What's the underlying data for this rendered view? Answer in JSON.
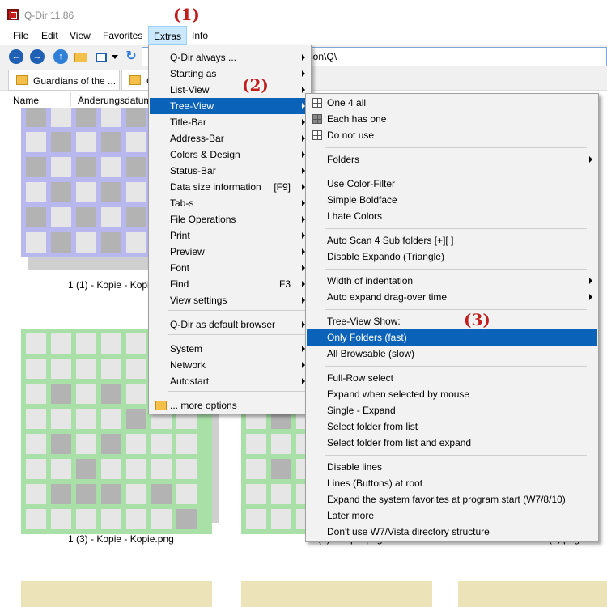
{
  "window": {
    "title": "Q-Dir 11.86"
  },
  "menubar": [
    "File",
    "Edit",
    "View",
    "Favorites",
    "Extras",
    "Info"
  ],
  "address": {
    "path": "g\\icon\\Q\\"
  },
  "tabs": [
    "Guardians of the ...",
    "C"
  ],
  "columns": {
    "name": "Name",
    "changed": "Änderungsdatum"
  },
  "files": [
    {
      "name": "1 (1) - Kopie - Kopie",
      "color": "#b8b8ee"
    },
    {
      "name": "1 (3) - Kopie - Kopie.png",
      "color": "#a8e0a8"
    },
    {
      "name": "1 (3) - Kopie.png",
      "color": "#a8e0a8"
    },
    {
      "name": "1 (3).png",
      "color": "#a8e0a8"
    },
    {
      "name": "",
      "color": "#ece4b8"
    }
  ],
  "extras_menu": {
    "items": [
      {
        "label": "Q-Dir always ...",
        "sub": true
      },
      {
        "label": "Starting as",
        "sub": true
      },
      {
        "label": "List-View",
        "sub": true
      },
      {
        "label": "Tree-View",
        "sub": true,
        "active": true
      },
      {
        "label": "Title-Bar",
        "sub": true
      },
      {
        "label": "Address-Bar",
        "sub": true
      },
      {
        "label": "Colors & Design",
        "sub": true
      },
      {
        "label": "Status-Bar",
        "sub": true
      },
      {
        "label": "Data size information",
        "shortcut": "[F9]",
        "sub": true
      },
      {
        "label": "Tab-s",
        "sub": true
      },
      {
        "label": "File Operations",
        "sub": true
      },
      {
        "label": "Print",
        "sub": true
      },
      {
        "label": "Preview",
        "sub": true
      },
      {
        "label": "Font",
        "sub": true
      },
      {
        "label": "Find",
        "shortcut": "F3",
        "sub": true
      },
      {
        "label": "View settings",
        "sub": true
      },
      {
        "label": "Q-Dir as default browser",
        "sub": true
      },
      {
        "label": "System",
        "sub": true
      },
      {
        "label": "Network",
        "sub": true
      },
      {
        "label": "Autostart",
        "sub": true
      },
      {
        "label": "... more options",
        "sub": false
      }
    ]
  },
  "treeview_menu": {
    "items": [
      {
        "label": "One 4 all",
        "icon": "grid-icon"
      },
      {
        "label": "Each has one",
        "icon": "grid-filled-icon"
      },
      {
        "label": "Do not use",
        "icon": "grid-icon"
      },
      {
        "label": "Folders",
        "sub": true
      },
      {
        "label": "Use Color-Filter"
      },
      {
        "label": "Simple Boldface"
      },
      {
        "label": "I hate Colors"
      },
      {
        "label": "Auto Scan 4 Sub folders  [+][ ]"
      },
      {
        "label": "Disable Expando (Triangle)"
      },
      {
        "label": "Width of indentation",
        "sub": true
      },
      {
        "label": "Auto expand drag-over time",
        "sub": true
      },
      {
        "label": "Tree-View Show:"
      },
      {
        "label": "Only Folders (fast)",
        "active": true
      },
      {
        "label": "All Browsable (slow)"
      },
      {
        "label": "Full-Row select"
      },
      {
        "label": "Expand when selected by mouse"
      },
      {
        "label": "Single - Expand"
      },
      {
        "label": "Select folder from list"
      },
      {
        "label": "Select folder from list and expand"
      },
      {
        "label": "Disable lines"
      },
      {
        "label": "Lines (Buttons) at root"
      },
      {
        "label": "Expand the system favorites at program start (W7/8/10)"
      },
      {
        "label": "Later more"
      },
      {
        "label": "Don't use W7/Vista directory structure"
      }
    ]
  },
  "annotations": [
    "(1)",
    "(2)",
    "(3)"
  ],
  "colors": {
    "highlight": "#0a63b8",
    "annotation": "#c21d1d",
    "menu_bg": "#f2f2f2"
  }
}
